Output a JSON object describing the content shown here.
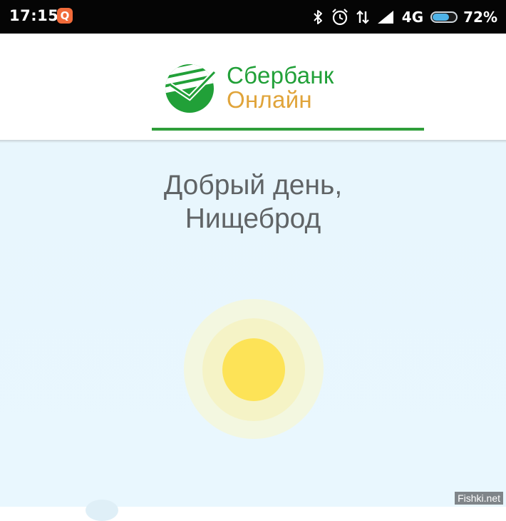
{
  "status_bar": {
    "time": "17:15",
    "app_badge": "Q",
    "network": "4G",
    "battery_percent": "72%",
    "battery_level": 0.72,
    "icons": [
      "bluetooth-icon",
      "alarm-icon",
      "data-transfer-icon",
      "signal-icon",
      "battery-icon"
    ]
  },
  "header": {
    "brand_line1": "Сбербанк",
    "brand_line2": "Онлайн",
    "colors": {
      "green": "#21a038",
      "orange": "#e0a43a"
    }
  },
  "main": {
    "greeting_line1": "Добрый день,",
    "greeting_line2": "Нищеброд"
  },
  "watermark": "Fishki.net"
}
